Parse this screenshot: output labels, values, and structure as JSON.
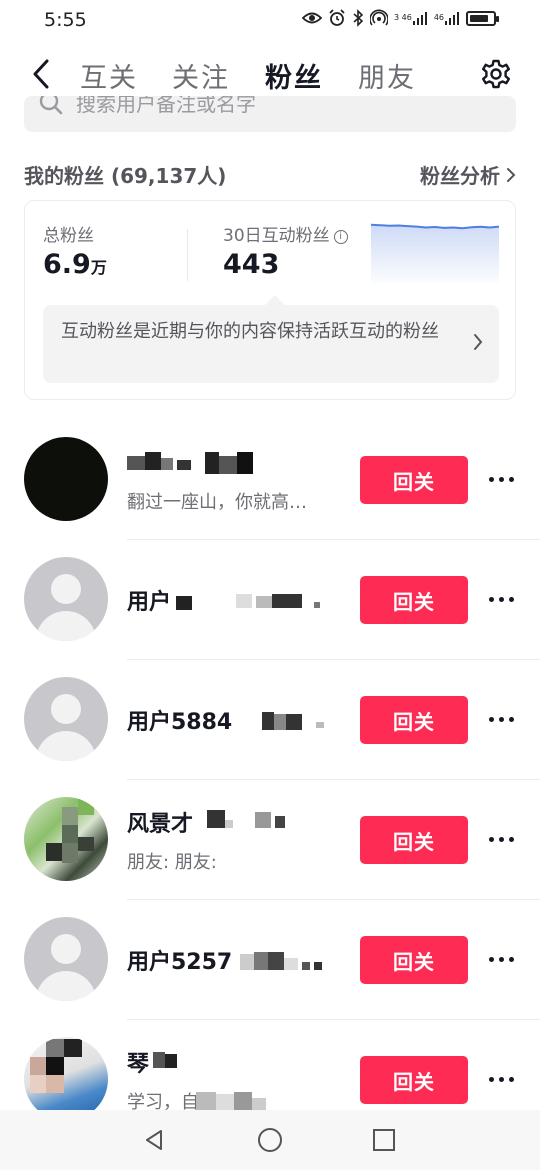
{
  "status_bar": {
    "time": "5:55",
    "signal1": "3 46",
    "signal2": "46",
    "battery_level": 0.8
  },
  "nav": {
    "tabs": [
      {
        "label": "互关"
      },
      {
        "label": "关注"
      },
      {
        "label": "粉丝"
      },
      {
        "label": "朋友"
      }
    ],
    "active_tab": "粉丝"
  },
  "search": {
    "placeholder": "搜索用户备注或名字"
  },
  "fans_header": {
    "title": "我的粉丝 (69,137人)",
    "analysis_link": "粉丝分析"
  },
  "stats": {
    "total_label": "总粉丝",
    "total_value": "6.9",
    "total_unit": "万",
    "active_label": "30日互动粉丝",
    "active_value": "443",
    "sparkline": [
      0.92,
      0.9,
      0.88,
      0.89,
      0.86,
      0.84,
      0.8,
      0.82,
      0.78,
      0.8,
      0.77,
      0.81,
      0.83,
      0.8,
      0.84
    ],
    "tip": "互动粉丝是近期与你的内容保持活跃互动的粉丝"
  },
  "fans": [
    {
      "name": "",
      "sub": "翻过一座山，你就高…",
      "action": "回关"
    },
    {
      "name": "用户",
      "sub": "",
      "action": "回关"
    },
    {
      "name": "用户5884",
      "sub": "",
      "action": "回关"
    },
    {
      "name": "风景才",
      "sub": "朋友:   朋友:",
      "action": "回关"
    },
    {
      "name": "用户5257",
      "sub": "",
      "action": "回关"
    },
    {
      "name": "琴",
      "sub": "学习，自   旅…",
      "action": "回关"
    }
  ],
  "colors": {
    "accent": "#fe2c55",
    "text_primary": "#161823",
    "text_secondary": "#6e6f75",
    "sparkline": "#4f7ee0"
  },
  "icons": {
    "back": "back-chevron-icon",
    "settings": "gear-icon",
    "search": "search-icon",
    "info": "info-icon",
    "more": "more-dots-icon"
  }
}
